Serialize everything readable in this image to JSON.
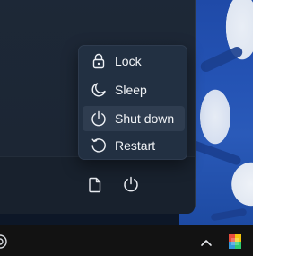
{
  "power_menu": {
    "items": [
      {
        "label": "Lock",
        "icon": "lock-icon"
      },
      {
        "label": "Sleep",
        "icon": "moon-icon"
      },
      {
        "label": "Shut down",
        "icon": "power-icon",
        "highlighted": true
      },
      {
        "label": "Restart",
        "icon": "restart-icon"
      }
    ]
  },
  "start_footer": {
    "icons": [
      "document-icon",
      "power-icon"
    ]
  },
  "taskbar": {
    "icons": [
      "start-partial-icon",
      "chevron-up-icon",
      "colorful-app-icon"
    ]
  },
  "colors": {
    "menu_background": "#223042",
    "menu_hover": "#2f3d50",
    "panel_background": "#1d2837",
    "wallpaper_blue": "#2453b4",
    "text": "#f2f4f7"
  }
}
